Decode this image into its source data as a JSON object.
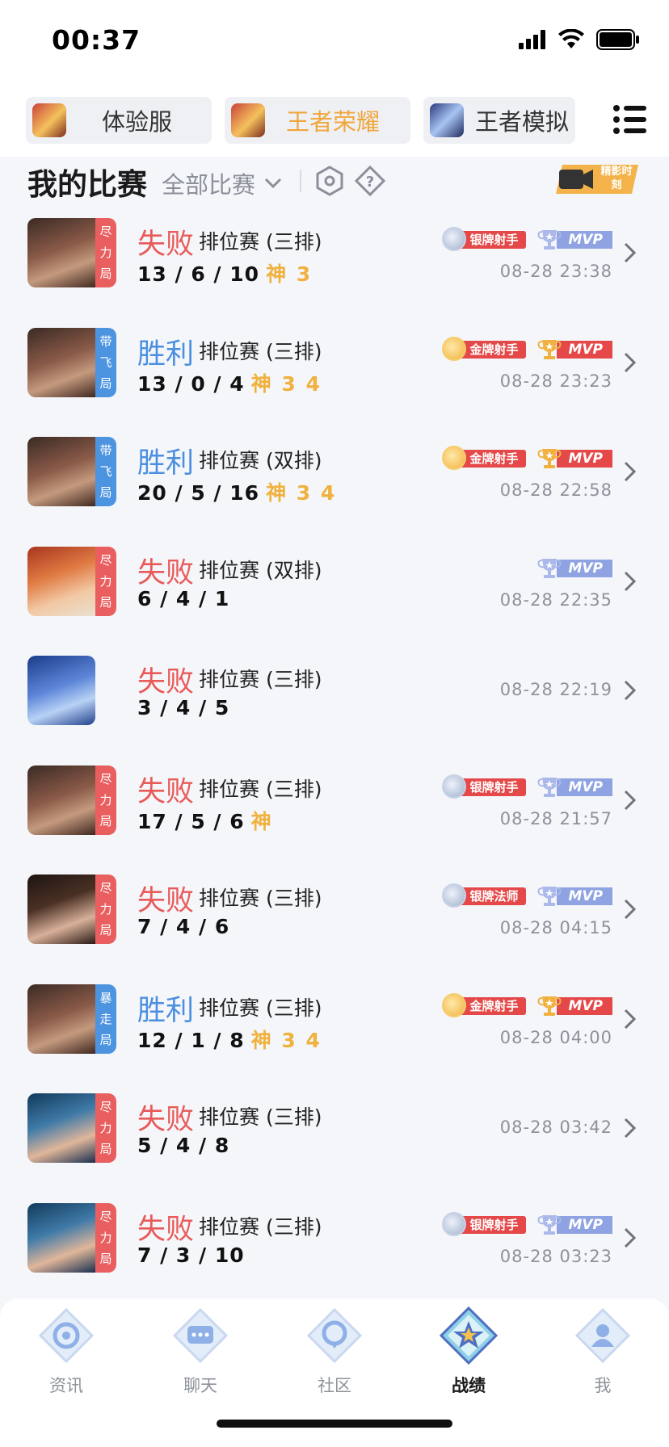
{
  "status_bar": {
    "time": "00:37"
  },
  "app_tabs": [
    {
      "label": "体验服",
      "active": false
    },
    {
      "label": "王者荣耀",
      "active": true
    },
    {
      "label": "王者模拟",
      "active": false
    }
  ],
  "header": {
    "title": "我的比赛",
    "filter_label": "全部比赛",
    "highlight_label": "精影时刻"
  },
  "matches": [
    {
      "result": "失败",
      "outcome": "lose",
      "mode": "排位赛 (三排)",
      "kda": "13 / 6 / 10",
      "extra": "神 3",
      "tag": [
        "尽",
        "力",
        "局"
      ],
      "tag_color": "red",
      "badge": "银牌射手",
      "badge_type": "silver",
      "mvp": "MVP",
      "mvp_type": "silver",
      "time": "08-28 23:38"
    },
    {
      "result": "胜利",
      "outcome": "win",
      "mode": "排位赛 (三排)",
      "kda": "13 / 0 / 4",
      "extra": "神 3 4",
      "tag": [
        "带",
        "飞",
        "局"
      ],
      "tag_color": "blue",
      "badge": "金牌射手",
      "badge_type": "gold",
      "mvp": "MVP",
      "mvp_type": "gold",
      "time": "08-28 23:23"
    },
    {
      "result": "胜利",
      "outcome": "win",
      "mode": "排位赛 (双排)",
      "kda": "20 / 5 / 16",
      "extra": "神 3 4",
      "tag": [
        "带",
        "飞",
        "局"
      ],
      "tag_color": "blue",
      "badge": "金牌射手",
      "badge_type": "gold",
      "mvp": "MVP",
      "mvp_type": "gold",
      "time": "08-28 22:58"
    },
    {
      "result": "失败",
      "outcome": "lose",
      "mode": "排位赛 (双排)",
      "kda": "6 / 4 / 1",
      "extra": "",
      "tag": [
        "尽",
        "力",
        "局"
      ],
      "tag_color": "red",
      "badge": "",
      "badge_type": "",
      "mvp": "MVP",
      "mvp_type": "silver",
      "time": "08-28 22:35"
    },
    {
      "result": "失败",
      "outcome": "lose",
      "mode": "排位赛 (三排)",
      "kda": "3 / 4 / 5",
      "extra": "",
      "tag": [],
      "tag_color": "",
      "badge": "",
      "badge_type": "",
      "mvp": "",
      "mvp_type": "",
      "time": "08-28 22:19"
    },
    {
      "result": "失败",
      "outcome": "lose",
      "mode": "排位赛 (三排)",
      "kda": "17 / 5 / 6",
      "extra": "神",
      "tag": [
        "尽",
        "力",
        "局"
      ],
      "tag_color": "red",
      "badge": "银牌射手",
      "badge_type": "silver",
      "mvp": "MVP",
      "mvp_type": "silver",
      "time": "08-28 21:57"
    },
    {
      "result": "失败",
      "outcome": "lose",
      "mode": "排位赛 (三排)",
      "kda": "7 / 4 / 6",
      "extra": "",
      "tag": [
        "尽",
        "力",
        "局"
      ],
      "tag_color": "red",
      "badge": "银牌法师",
      "badge_type": "silver",
      "mvp": "MVP",
      "mvp_type": "silver",
      "time": "08-28 04:15"
    },
    {
      "result": "胜利",
      "outcome": "win",
      "mode": "排位赛 (三排)",
      "kda": "12 / 1 / 8",
      "extra": "神 3 4",
      "tag": [
        "暴",
        "走",
        "局"
      ],
      "tag_color": "blue",
      "badge": "金牌射手",
      "badge_type": "gold",
      "mvp": "MVP",
      "mvp_type": "gold",
      "time": "08-28 04:00"
    },
    {
      "result": "失败",
      "outcome": "lose",
      "mode": "排位赛 (三排)",
      "kda": "5 / 4 / 8",
      "extra": "",
      "tag": [
        "尽",
        "力",
        "局"
      ],
      "tag_color": "red",
      "badge": "",
      "badge_type": "",
      "mvp": "",
      "mvp_type": "",
      "time": "08-28 03:42"
    },
    {
      "result": "失败",
      "outcome": "lose",
      "mode": "排位赛 (三排)",
      "kda": "7 / 3 / 10",
      "extra": "",
      "tag": [
        "尽",
        "力",
        "局"
      ],
      "tag_color": "red",
      "badge": "银牌射手",
      "badge_type": "silver",
      "mvp": "MVP",
      "mvp_type": "silver",
      "time": "08-28 03:23"
    }
  ],
  "bottom_nav": [
    {
      "label": "资讯",
      "icon": "news-icon",
      "active": false
    },
    {
      "label": "聊天",
      "icon": "chat-icon",
      "active": false
    },
    {
      "label": "社区",
      "icon": "community-icon",
      "active": false
    },
    {
      "label": "战绩",
      "icon": "record-icon",
      "active": true
    },
    {
      "label": "我",
      "icon": "profile-icon",
      "active": false
    }
  ],
  "colors": {
    "win": "#4a8fe0",
    "lose": "#e95a5a",
    "kda_extra": "#f0b13e",
    "badge_red": "#e54848",
    "mvp_silver": "#8fa3e2"
  }
}
